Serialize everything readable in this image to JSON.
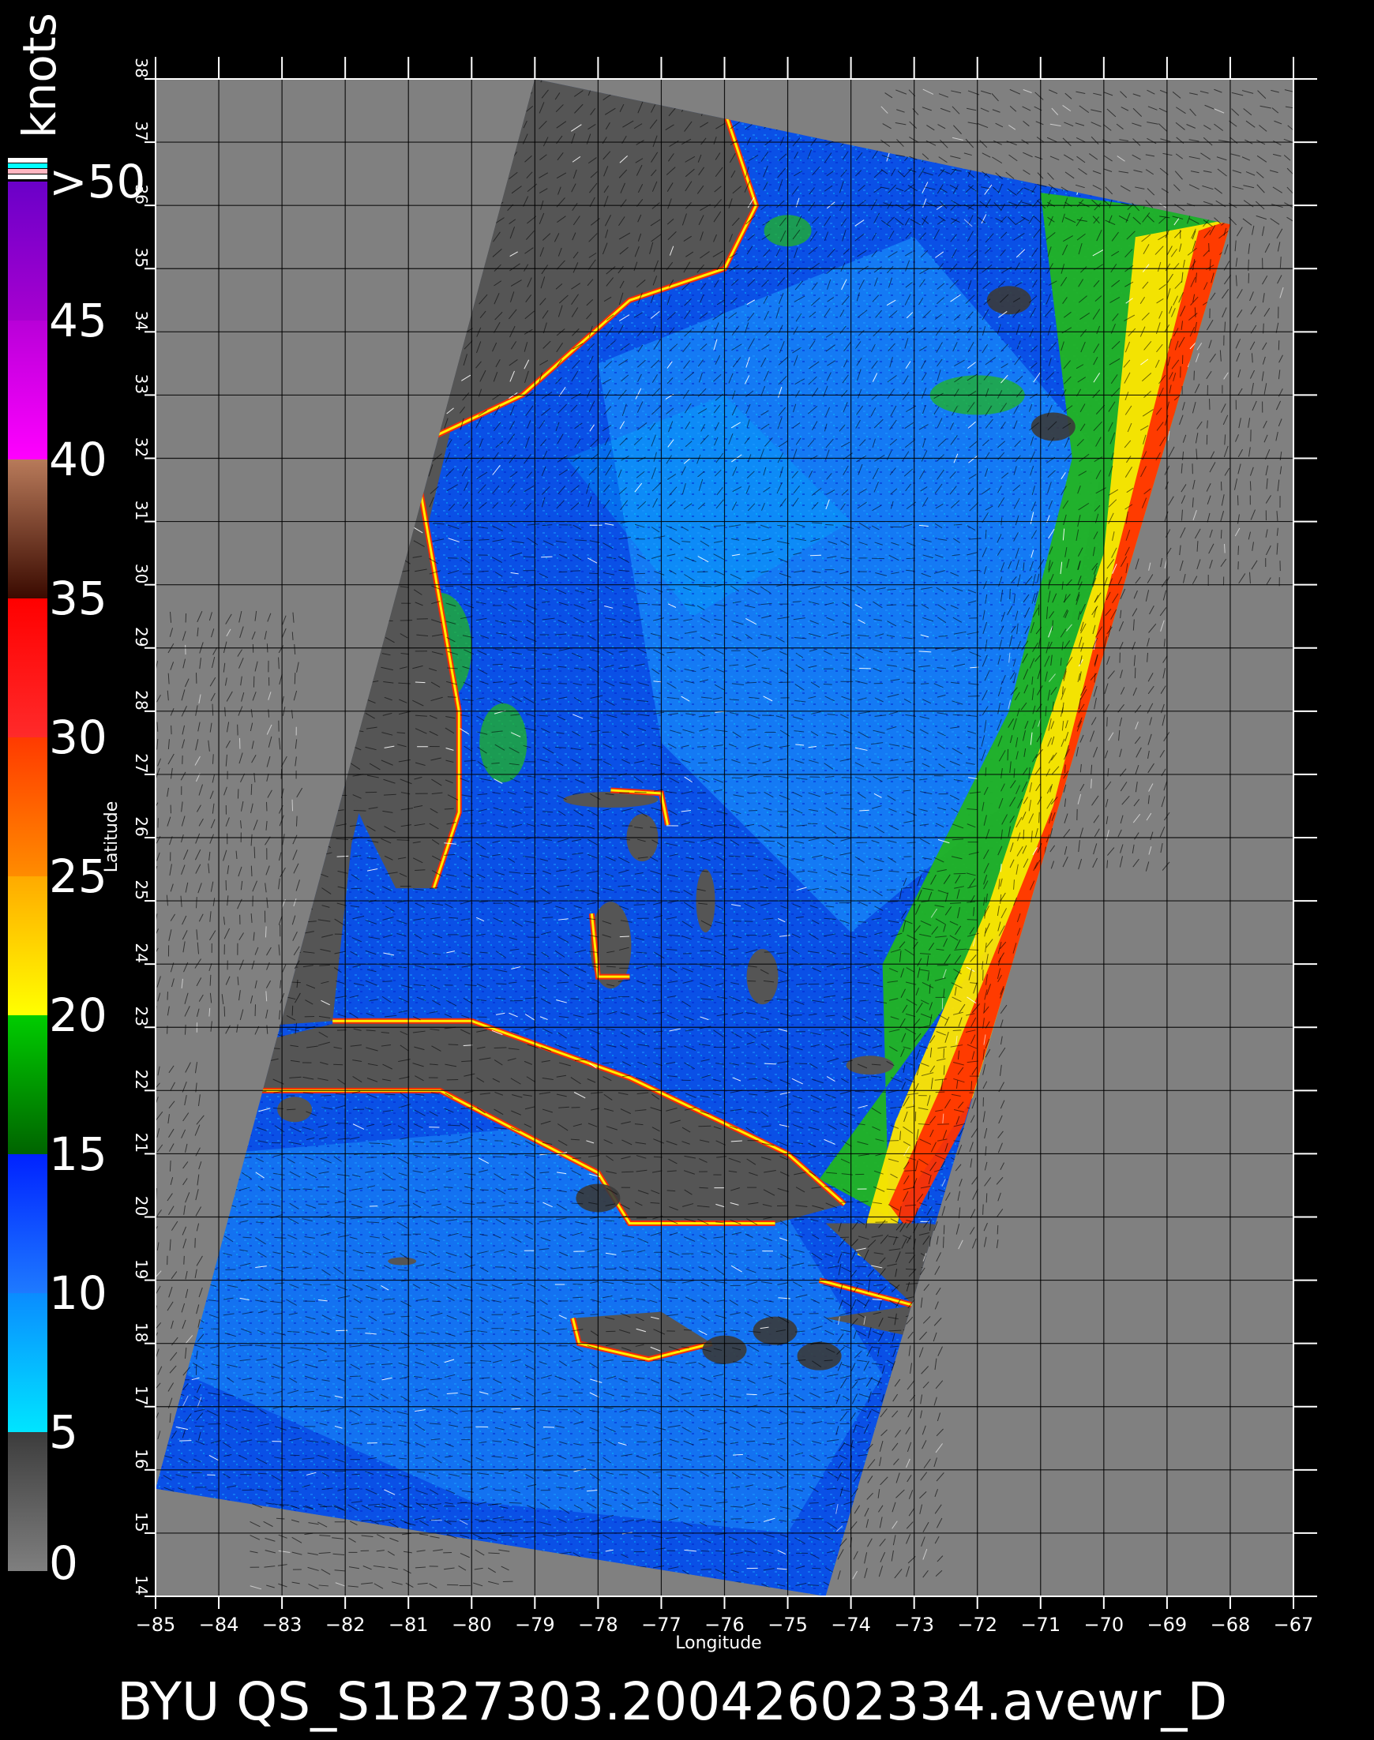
{
  "title": "BYU  QS_S1B27303.20042602334.avewr_D",
  "units_label": "knots",
  "x_axis_label": "Longitude",
  "y_axis_label": "Latitude",
  "colorbar": {
    "labels": [
      "0",
      "5",
      "10",
      "15",
      "20",
      "25",
      "30",
      "35",
      "40",
      "45",
      ">50"
    ],
    "segments": [
      {
        "from": 0,
        "to": 5,
        "colors": [
          "#7f7f7f",
          "#3c3c3c"
        ]
      },
      {
        "from": 5,
        "to": 10,
        "colors": [
          "#00e5ff",
          "#0a8cff"
        ]
      },
      {
        "from": 10,
        "to": 15,
        "colors": [
          "#1e7aff",
          "#0022ff"
        ]
      },
      {
        "from": 15,
        "to": 20,
        "colors": [
          "#006400",
          "#00cc00"
        ]
      },
      {
        "from": 20,
        "to": 25,
        "colors": [
          "#ffff00",
          "#ffaa00"
        ]
      },
      {
        "from": 25,
        "to": 30,
        "colors": [
          "#ff8c00",
          "#ff3a00"
        ]
      },
      {
        "from": 30,
        "to": 35,
        "colors": [
          "#ff2a2a",
          "#ff0000"
        ]
      },
      {
        "from": 35,
        "to": 40,
        "colors": [
          "#3a0a00",
          "#b87a5a"
        ]
      },
      {
        "from": 40,
        "to": 45,
        "colors": [
          "#ff00ff",
          "#b800d8"
        ]
      },
      {
        "from": 45,
        "to": 50,
        "colors": [
          "#a800d0",
          "#6a00c8"
        ]
      }
    ],
    "top_stripes": [
      "#ffffff",
      "#00ffff",
      "#ffb6c1",
      "#ffffff"
    ]
  },
  "map": {
    "lon_range": [
      -85,
      -67
    ],
    "lat_range": [
      14,
      38
    ],
    "lon_ticks": [
      "−85",
      "−84",
      "−83",
      "−82",
      "−81",
      "−80",
      "−79",
      "−78",
      "−77",
      "−76",
      "−75",
      "−74",
      "−73",
      "−72",
      "−71",
      "−70",
      "−69",
      "−68",
      "−67"
    ],
    "lat_ticks": [
      "14",
      "15",
      "16",
      "17",
      "18",
      "19",
      "20",
      "21",
      "22",
      "23",
      "24",
      "25",
      "26",
      "27",
      "28",
      "29",
      "30",
      "31",
      "32",
      "33",
      "34",
      "35",
      "36",
      "37",
      "38"
    ],
    "grid": true,
    "colors": {
      "no_data": "#808080",
      "land": "#555555",
      "ocean_main": "#0a50e6",
      "ocean_light": "#1e9cff",
      "calm_band": "#00b4ff",
      "strong_wind_green": "#22b422",
      "strong_wind_yellow": "#ffe600",
      "strong_wind_red": "#ff3200"
    },
    "swath_corners": [
      [
        -79.0,
        38.0
      ],
      [
        -68.0,
        35.7
      ],
      [
        -74.4,
        14.0
      ],
      [
        -85.0,
        15.7
      ]
    ]
  }
}
